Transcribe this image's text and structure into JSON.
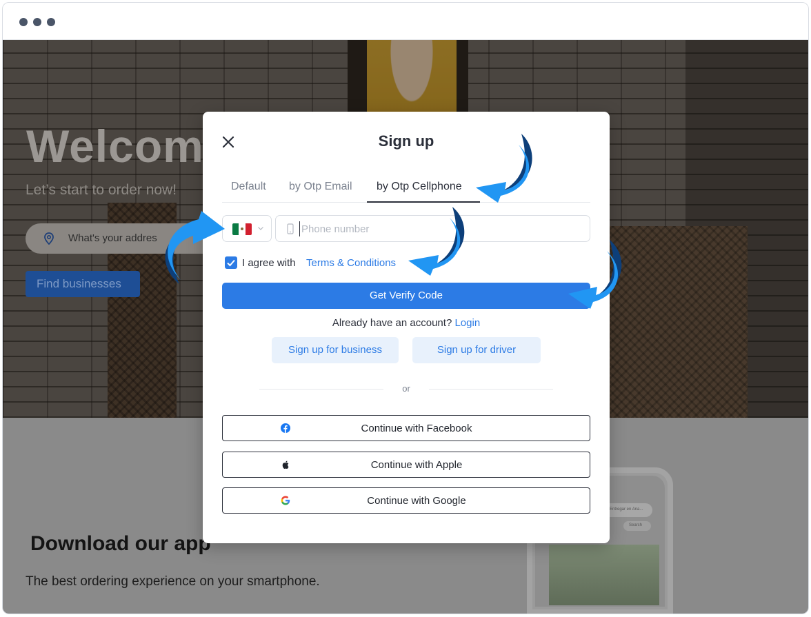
{
  "page": {
    "hero": {
      "welcome": "Welcom",
      "subtitle": "Let’s start to order now!",
      "address_placeholder": "What's your addres",
      "find_button": "Find businesses"
    },
    "app_section": {
      "title": "Download our app",
      "subtitle": "The best ordering experience on your smartphone.",
      "phone_search_text": "Entregar en Ana...",
      "phone_search_button": "Search"
    }
  },
  "modal": {
    "title": "Sign up",
    "tabs": [
      {
        "label": "Default",
        "active": false
      },
      {
        "label": "by Otp Email",
        "active": false
      },
      {
        "label": "by Otp Cellphone",
        "active": true
      }
    ],
    "country_flag": "mexico-flag-icon",
    "phone_placeholder": "Phone number",
    "agree_text": "I agree with",
    "terms_link": "Terms & Conditions",
    "agree_checked": true,
    "verify_button": "Get Verify Code",
    "already_text": "Already have an account?",
    "login_link": "Login",
    "business_button": "Sign up for business",
    "driver_button": "Sign up for driver",
    "or_text": "or",
    "social": [
      {
        "label": "Continue with Facebook",
        "icon": "facebook-icon"
      },
      {
        "label": "Continue with Apple",
        "icon": "apple-icon"
      },
      {
        "label": "Continue with Google",
        "icon": "google-icon"
      }
    ]
  },
  "colors": {
    "primary": "#2c7be5",
    "annotation_arrow": "#2196f3",
    "annotation_arrow_dark": "#0d3f7a"
  }
}
